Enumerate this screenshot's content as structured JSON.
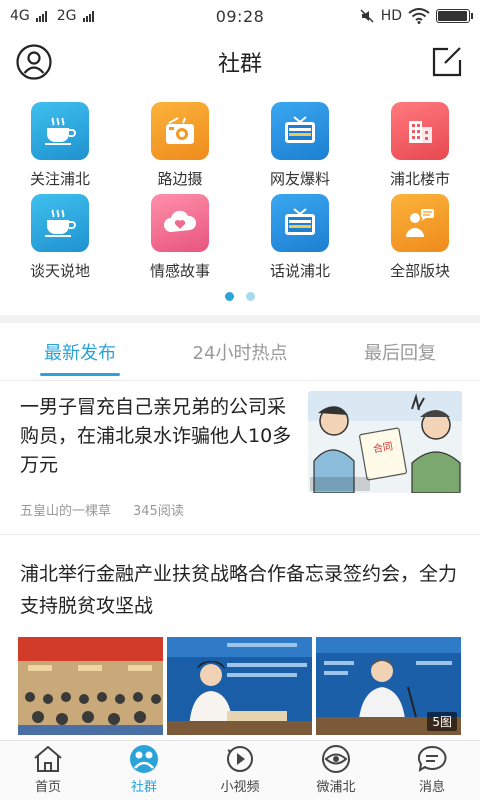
{
  "status_bar": {
    "network1": "4G",
    "network2": "2G",
    "time": "09:28",
    "hd": "HD",
    "battery_level": 0.95
  },
  "header": {
    "title": "社群"
  },
  "categories": [
    {
      "label": "关注浦北",
      "icon": "coffee-cup-icon",
      "color": "#29a9dd"
    },
    {
      "label": "路边摄",
      "icon": "camera-icon",
      "color": "#f39a25"
    },
    {
      "label": "网友爆料",
      "icon": "breaking-news-tv-icon",
      "color": "#2d8fe0"
    },
    {
      "label": "浦北楼市",
      "icon": "building-icon",
      "color": "#ef5a60"
    },
    {
      "label": "谈天说地",
      "icon": "coffee-cup-icon",
      "color": "#29a9dd"
    },
    {
      "label": "情感故事",
      "icon": "cloud-heart-icon",
      "color": "#f06b8e"
    },
    {
      "label": "话说浦北",
      "icon": "breaking-news-tv-icon",
      "color": "#2d8fe0"
    },
    {
      "label": "全部版块",
      "icon": "person-speech-icon",
      "color": "#f39a25"
    }
  ],
  "pager": {
    "count": 2,
    "active_index": 0,
    "active_color": "#2aa3d8",
    "inactive_color": "#a9d9ef"
  },
  "tabs": [
    {
      "label": "最新发布",
      "active": true
    },
    {
      "label": "24小时热点",
      "active": false
    },
    {
      "label": "最后回复",
      "active": false
    }
  ],
  "feed": {
    "post1": {
      "title": "一男子冒充自己亲兄弟的公司采购员，在浦北泉水诈骗他人10多万元",
      "author": "五皇山的一棵草",
      "reads": "345阅读"
    },
    "post2": {
      "title": "浦北举行金融产业扶贫战略合作备忘录签约会，全力支持脱贫攻坚战",
      "image_count": "5图"
    }
  },
  "bottom_nav": [
    {
      "label": "首页",
      "icon": "home-icon",
      "active": false
    },
    {
      "label": "社群",
      "icon": "community-icon",
      "active": true
    },
    {
      "label": "小视频",
      "icon": "play-video-icon",
      "active": false
    },
    {
      "label": "微浦北",
      "icon": "eye-icon",
      "active": false
    },
    {
      "label": "消息",
      "icon": "message-icon",
      "active": false
    }
  ],
  "colors": {
    "accent": "#2aa3d8"
  }
}
